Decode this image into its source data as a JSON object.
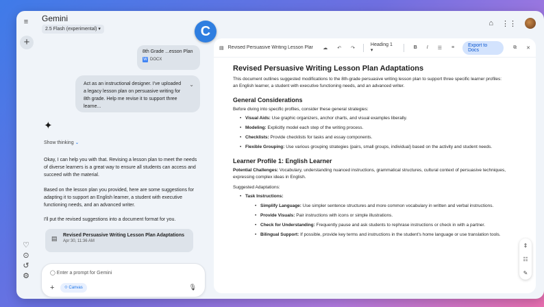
{
  "app": {
    "title": "Gemini",
    "model": "2.5 Flash (experimental) ▾",
    "badge": "C"
  },
  "rail_icons": [
    "menu-icon",
    "new-chat-icon",
    "gem-icon",
    "activity-icon",
    "history-icon",
    "settings-icon"
  ],
  "chat": {
    "file": {
      "name": "8th Grade ...esson Plan",
      "type": "DOCX"
    },
    "user_message": "Act as an instructional designer. I've uploaded a legacy lesson plan on persuasive writing for 8th grade. Help me revise it to support three learne...",
    "show_thinking": "Show thinking",
    "reply": [
      "Okay, I can help you with that. Revising a lesson plan to meet the needs of diverse learners is a great way to ensure all students can access and succeed with the material.",
      "Based on the lesson plan you provided, here are some suggestions for adapting it to support an English learner, a student with executive functioning needs, and an advanced writer.",
      "I'll put the revised suggestions into a document format for you."
    ],
    "doc_card": {
      "title": "Revised Persuasive Writing Lesson Plan Adaptations",
      "date": "Apr 30, 11:36 AM"
    },
    "composer": {
      "placeholder": "Enter a prompt for Gemini",
      "canvas": "Canvas"
    }
  },
  "doc_toolbar": {
    "title": "Revised Persuasive Writing Lesson Plan...",
    "heading": "Heading 1",
    "bold": "B",
    "italic": "I",
    "export": "Export to Docs"
  },
  "document": {
    "title": "Revised Persuasive Writing Lesson Plan Adaptations",
    "intro": "This document outlines suggested modifications to the 8th-grade persuasive writing lesson plan to support three specific learner profiles: an English learner, a student with executive functioning needs, and an advanced writer.",
    "general_heading": "General Considerations",
    "general_intro": "Before diving into specific profiles, consider these general strategies:",
    "general_items": [
      {
        "label": "Visual Aids:",
        "text": " Use graphic organizers, anchor charts, and visual examples liberally."
      },
      {
        "label": "Modeling:",
        "text": " Explicitly model each step of the writing process."
      },
      {
        "label": "Checklists:",
        "text": " Provide checklists for tasks and essay components."
      },
      {
        "label": "Flexible Grouping:",
        "text": " Use various grouping strategies (pairs, small groups, individual) based on the activity and student needs."
      }
    ],
    "profile1_heading": "Learner Profile 1: English Learner",
    "challenges_label": "Potential Challenges:",
    "challenges_text": " Vocabulary, understanding nuanced instructions, grammatical structures, cultural context of persuasive techniques, expressing complex ideas in English.",
    "suggested": "Suggested Adaptations:",
    "task_label": "Task Instructions:",
    "task_items": [
      {
        "label": "Simplify Language:",
        "text": " Use simpler sentence structures and more common vocabulary in written and verbal instructions."
      },
      {
        "label": "Provide Visuals:",
        "text": " Pair instructions with icons or simple illustrations."
      },
      {
        "label": "Check for Understanding:",
        "text": " Frequently pause and ask students to rephrase instructions or check in with a partner."
      },
      {
        "label": "Bilingual Support:",
        "text": " If possible, provide key terms and instructions in the student's home language or use translation tools."
      }
    ]
  }
}
